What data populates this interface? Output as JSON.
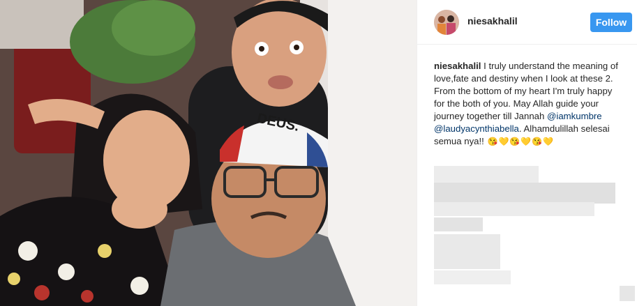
{
  "post": {
    "username": "niesakhalil",
    "follow_label": "Follow"
  },
  "caption": {
    "username": "niesakhalil",
    "text_1": " I truly understand the meaning of love,fate and destiny when I look at these 2. From the bottom of my heart I'm truly happy for the both of you. May Allah guide your journey together till Jannah ",
    "mention_1": "@iamkumbre",
    "mention_2": "@laudyacynthiabella",
    "text_2": ". Alhamdulillah selesai semua nya!! ",
    "emojis": [
      "😘",
      "💛",
      "😘",
      "💛",
      "😘",
      "💛"
    ]
  },
  "photo": {
    "cap_text": "DEUS."
  },
  "colors": {
    "accent": "#3897f0",
    "link": "#003569",
    "text": "#262626"
  }
}
